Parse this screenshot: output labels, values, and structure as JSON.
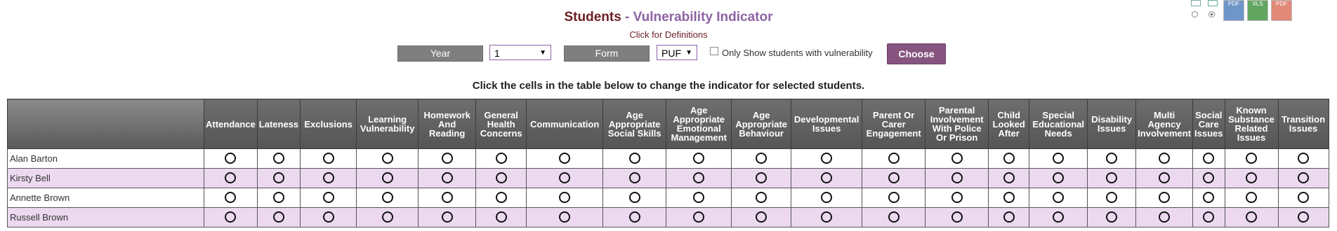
{
  "header": {
    "title_part1": "Students",
    "title_sep": " - ",
    "title_part2": "Vulnerability Indicator",
    "definitions_link": "Click for Definitions"
  },
  "filters": {
    "year_label": "Year",
    "year_value": "1",
    "form_label": "Form",
    "form_value": "PUF",
    "only_show_label": "Only Show students with vulnerability",
    "choose_label": "Choose"
  },
  "instruction": "Click the cells in the table below to change the indicator for selected students.",
  "export_icons": [
    "image-view-icon",
    "pdf-export-icon",
    "excel-export-icon",
    "pdf-export-icon-2"
  ],
  "colors": {
    "accent": "#85557f",
    "title_dark": "#6b1f24",
    "title_light": "#8d63a5",
    "row_alt": "#ecd9f0"
  },
  "table": {
    "columns": [
      "Attendance",
      "Lateness",
      "Exclusions",
      "Learning Vulnerability",
      "Homework And Reading",
      "General Health Concerns",
      "Communication",
      "Age Appropriate Social Skills",
      "Age Appropriate Emotional Management",
      "Age Appropriate Behaviour",
      "Developmental Issues",
      "Parent Or Carer Engagement",
      "Parental Involvement With Police Or Prison",
      "Child Looked After",
      "Special Educational Needs",
      "Disability Issues",
      "Multi Agency Involvement",
      "Social Care Issues",
      "Known Substance Related Issues",
      "Transition Issues"
    ],
    "rows": [
      {
        "name": "Alan Barton"
      },
      {
        "name": "Kirsty Bell"
      },
      {
        "name": "Annette Brown"
      },
      {
        "name": "Russell Brown"
      }
    ]
  }
}
